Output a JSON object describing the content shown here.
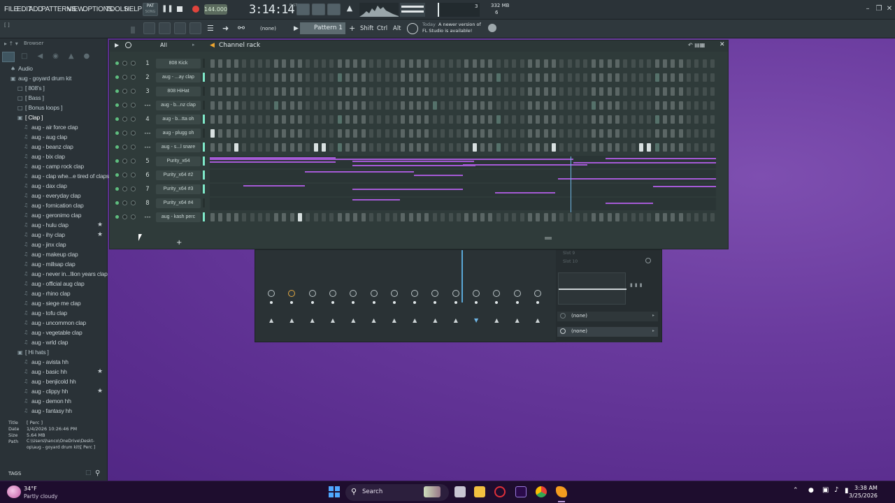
{
  "menu": [
    "FILE",
    "EDIT",
    "ADD",
    "PATTERNS",
    "VIEW",
    "OPTIONS",
    "TOOLS",
    "HELP"
  ],
  "transport": {
    "mode_top": "PAT",
    "mode_bottom": "SONG",
    "tempo": "144.000",
    "time": "3:14:14",
    "time_sub": "B:ST",
    "cpu_num": "3",
    "mem": "332 MB",
    "poly": "6"
  },
  "toolbar2": {
    "hint": "[ ]",
    "pattern_selector": "(none)",
    "pattern": "Pattern 1",
    "shift": "Shift",
    "ctrl": "Ctrl",
    "alt": "Alt",
    "news_when": "Today",
    "news_line1": "A newer version of",
    "news_line2": "FL Studio is available!"
  },
  "browser": {
    "title": "Browser",
    "items": [
      {
        "label": "Audio",
        "kind": "root"
      },
      {
        "label": "aug - goyard drum kit",
        "kind": "open"
      },
      {
        "label": "[ 808's ]",
        "kind": "folder"
      },
      {
        "label": "[ Bass ]",
        "kind": "folder"
      },
      {
        "label": "[ Bonus loops ]",
        "kind": "folder"
      },
      {
        "label": "[ Clap ]",
        "kind": "open"
      },
      {
        "label": "aug - air force clap",
        "kind": "file"
      },
      {
        "label": "aug - aug clap",
        "kind": "file"
      },
      {
        "label": "aug - beanz clap",
        "kind": "file"
      },
      {
        "label": "aug - bix clap",
        "kind": "file"
      },
      {
        "label": "aug - camp rock clap",
        "kind": "file"
      },
      {
        "label": "aug - clap whe...e tired of claps",
        "kind": "file"
      },
      {
        "label": "aug - dax clap",
        "kind": "file"
      },
      {
        "label": "aug - everyday clap",
        "kind": "file"
      },
      {
        "label": "aug - fornication clap",
        "kind": "file"
      },
      {
        "label": "aug - geronimo clap",
        "kind": "file"
      },
      {
        "label": "aug - hulu clap",
        "kind": "file",
        "star": true
      },
      {
        "label": "aug - ihy clap",
        "kind": "file",
        "star": true
      },
      {
        "label": "aug - jinx clap",
        "kind": "file"
      },
      {
        "label": "aug - makeup clap",
        "kind": "file"
      },
      {
        "label": "aug - millsap clap",
        "kind": "file"
      },
      {
        "label": "aug - never in...llion years clap",
        "kind": "file"
      },
      {
        "label": "aug - official aug clap",
        "kind": "file"
      },
      {
        "label": "aug - rhino clap",
        "kind": "file"
      },
      {
        "label": "aug - siege me clap",
        "kind": "file"
      },
      {
        "label": "aug - tofu clap",
        "kind": "file"
      },
      {
        "label": "aug - uncommon clap",
        "kind": "file"
      },
      {
        "label": "aug - vegetable clap",
        "kind": "file"
      },
      {
        "label": "aug - wrld clap",
        "kind": "file"
      },
      {
        "label": "[ Hi hats ]",
        "kind": "open"
      },
      {
        "label": "aug - avista hh",
        "kind": "file"
      },
      {
        "label": "aug - basic hh",
        "kind": "file",
        "star": true
      },
      {
        "label": "aug - benjicold hh",
        "kind": "file"
      },
      {
        "label": "aug - clippy hh",
        "kind": "file",
        "star": true
      },
      {
        "label": "aug - demon hh",
        "kind": "file"
      },
      {
        "label": "aug - fantasy hh",
        "kind": "file"
      }
    ],
    "info": {
      "title_k": "Title",
      "title_v": "[ Perc ]",
      "date_k": "Date",
      "date_v": "1/4/2026 10:26:46 PM",
      "size_k": "Size",
      "size_v": "5.64 MB",
      "path_k": "Path",
      "path_v1": "C:\\Users\\hanco\\OneDrive\\Deskt-",
      "path_v2": "op\\aug - goyard drum kit\\[ Perc ]"
    },
    "tags": "TAGS"
  },
  "rack": {
    "filter": "All",
    "title": "Channel rack",
    "channels": [
      {
        "num": "1",
        "name": "808 Kick",
        "type": "steps",
        "sel": false,
        "on": []
      },
      {
        "num": "2",
        "name": "aug - ...ay clap",
        "type": "steps",
        "sel": true,
        "on": [],
        "dim": [
          16,
          36,
          56,
          76
        ]
      },
      {
        "num": "3",
        "name": "808 HiHat",
        "type": "steps",
        "sel": false,
        "on": []
      },
      {
        "num": "---",
        "name": "aug - b...nz clap",
        "type": "steps",
        "sel": false,
        "on": [],
        "dim": [
          8,
          28,
          48,
          68
        ]
      },
      {
        "num": "4",
        "name": "aug - b...tta oh",
        "type": "steps",
        "sel": true,
        "on": [],
        "dim": [
          16,
          36,
          56,
          76
        ]
      },
      {
        "num": "---",
        "name": "aug - plugg oh",
        "type": "steps",
        "sel": false,
        "on": [
          0
        ]
      },
      {
        "num": "---",
        "name": "aug - s...l snare",
        "type": "steps",
        "sel": true,
        "on": [
          3,
          13,
          14,
          33,
          43,
          54,
          55,
          74
        ],
        "dim": [
          16,
          36,
          56,
          76
        ]
      },
      {
        "num": "5",
        "name": "Purity_x64",
        "type": "piano",
        "sel": true
      },
      {
        "num": "6",
        "name": "Purity_x64 #2",
        "type": "piano",
        "sel": true
      },
      {
        "num": "7",
        "name": "Purity_x64 #3",
        "type": "piano",
        "sel": true
      },
      {
        "num": "8",
        "name": "Purity_x64 #4",
        "type": "piano",
        "sel": false
      },
      {
        "num": "---",
        "name": "aug - kash perc",
        "type": "steps",
        "sel": true,
        "on": [
          11
        ]
      }
    ]
  },
  "panel": {
    "slot1": "Slot 9",
    "slot2": "Slot 10",
    "sel1": "(none)",
    "sel2": "(none)"
  },
  "taskbar": {
    "temp": "34°F",
    "weather": "Partly cloudy",
    "search": "Search",
    "time": "3:38 AM",
    "date": "3/25/2026"
  },
  "colors": {
    "accent": "#7ee8c8",
    "note": "#a55ad6",
    "desktop": "#6a3b9e"
  }
}
